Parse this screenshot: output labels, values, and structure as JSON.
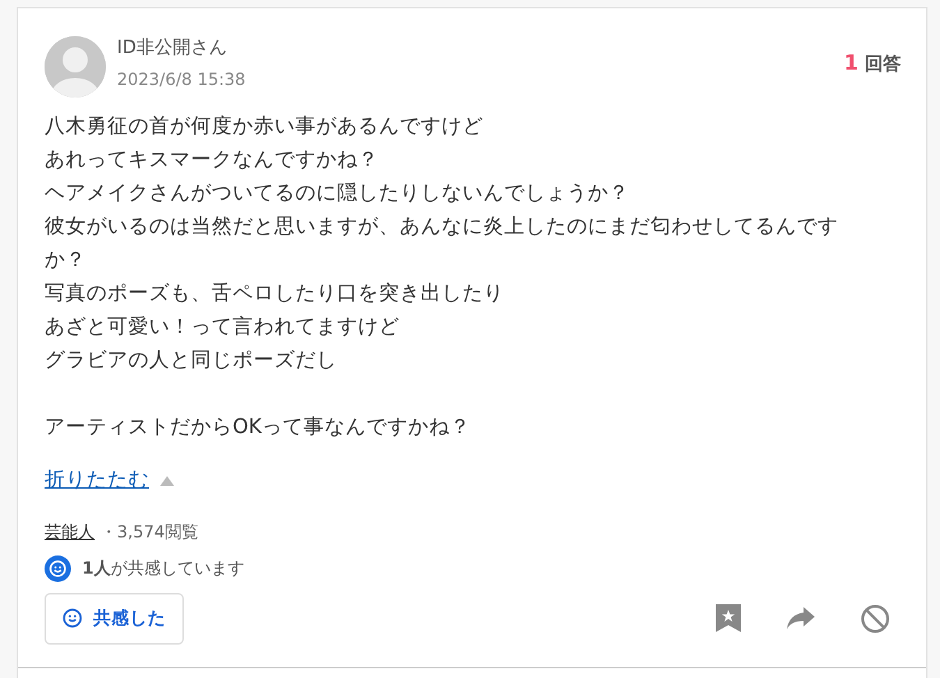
{
  "question": {
    "author": "ID非公開",
    "author_suffix": "さん",
    "date": "2023/6/8 15:38",
    "answer_count": "1",
    "answer_label": "回答",
    "paragraphs": [
      {
        "lines": [
          "八木勇征の首が何度か赤い事があるんですけど",
          "あれってキスマークなんですかね？",
          "ヘアメイクさんがついてるのに隠したりしないんでしょうか？",
          "彼女がいるのは当然だと思いますが、あんなに炎上したのにまだ匂わせしてるんですか？",
          "写真のポーズも、舌ペロしたり口を突き出したり",
          "あざと可愛い！って言われてますけど",
          "グラビアの人と同じポーズだし"
        ]
      },
      {
        "lines": [
          "アーティストだからOKって事なんですかね？"
        ]
      }
    ],
    "collapse_link": "折りたたむ",
    "expanded": true,
    "category": "芸能人",
    "views": "・3,574閲覧",
    "empathy_text": "**1人**が共感しています",
    "empathy_button": "共感した"
  }
}
